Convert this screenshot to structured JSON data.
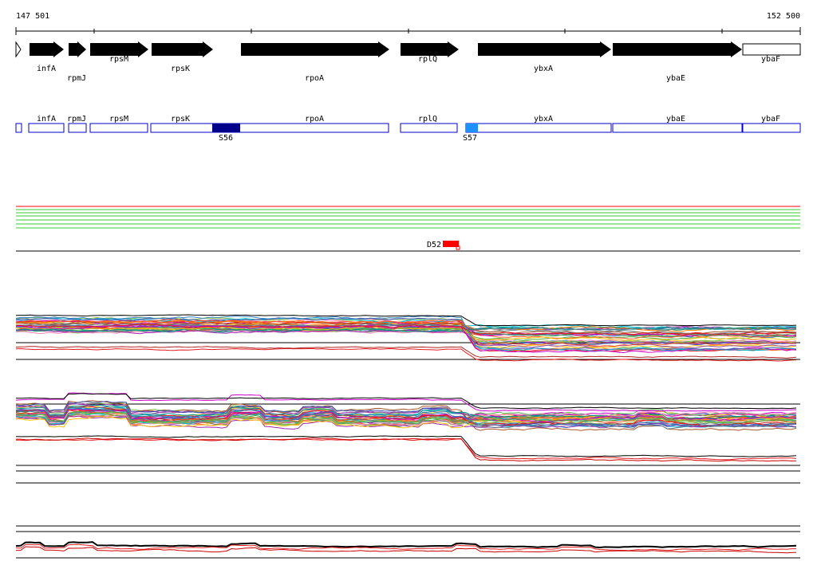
{
  "ruler": {
    "start_label": "147 501",
    "end_label": "152 500"
  },
  "genes": [
    {
      "name": "infA",
      "strand": "+"
    },
    {
      "name": "rpmJ",
      "strand": "+"
    },
    {
      "name": "rpsM",
      "strand": "+"
    },
    {
      "name": "rpsK",
      "strand": "+"
    },
    {
      "name": "rpoA",
      "strand": "+"
    },
    {
      "name": "rplQ",
      "strand": "+"
    },
    {
      "name": "ybxA",
      "strand": "+"
    },
    {
      "name": "ybaE",
      "strand": "+"
    },
    {
      "name": "ybaF",
      "strand": "+"
    }
  ],
  "operon_genes": [
    "infA",
    "rpmJ",
    "rpsM",
    "rpsK",
    "rpoA",
    "rplQ",
    "ybxA",
    "ybaE",
    "ybaF"
  ],
  "sites": [
    {
      "label": "S56",
      "color": "#00008b"
    },
    {
      "label": "S57",
      "color": "#1e90ff"
    }
  ],
  "deletion": {
    "label": "D52",
    "color": "#ff0000"
  },
  "colors": {
    "gene_fill": "#000000",
    "operon_stroke": "#0000cc",
    "reference_lines": [
      "#ff0000",
      "#33cc33"
    ],
    "trace_palette": [
      "#e41a1c",
      "#377eb8",
      "#4daf4a",
      "#984ea3",
      "#ff7f00",
      "#a65628",
      "#f781bf",
      "#00bcd4",
      "#8bc34a",
      "#9c27b0",
      "#3f51b5",
      "#009688",
      "#ff5722",
      "#607d8b",
      "#ffc107",
      "#cc00cc"
    ]
  }
}
